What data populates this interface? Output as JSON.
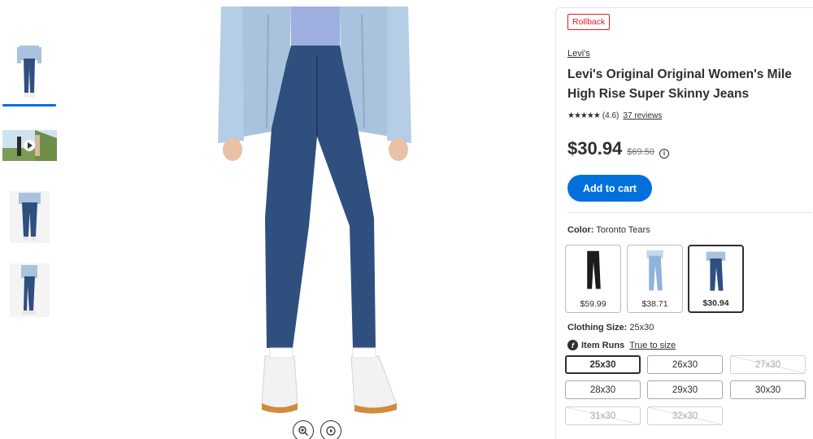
{
  "gallery": {
    "thumbnails": [
      {
        "alt": "front view",
        "selected": true
      },
      {
        "alt": "video thumbnail",
        "has_play": true
      },
      {
        "alt": "back view"
      },
      {
        "alt": "side view"
      }
    ],
    "controls": [
      "zoom-icon",
      "play-icon"
    ]
  },
  "product": {
    "badge": "Rollback",
    "brand": "Levi's",
    "title": "Levi's Original Original Women's Mile High Rise Super Skinny Jeans",
    "rating_value": "(4.6)",
    "reviews": "37 reviews",
    "stars": "★★★★★",
    "price": "$30.94",
    "was_price": "$69.50",
    "info_icon": "i",
    "add_to_cart": "Add to cart"
  },
  "color": {
    "label": "Color:",
    "value": "Toronto Tears",
    "swatches": [
      {
        "price": "$59.99",
        "jean": "#1b1b1d"
      },
      {
        "price": "$38.71",
        "jean": "#8fb3d9"
      },
      {
        "price": "$30.94",
        "jean": "#2f4f7f",
        "selected": true
      }
    ]
  },
  "size": {
    "label": "Clothing Size:",
    "value": "25x30",
    "runs_label": "Item Runs",
    "runs_value": "True to size",
    "runs_icon": "f",
    "options": [
      {
        "label": "25x30",
        "state": "selected"
      },
      {
        "label": "26x30",
        "state": "available"
      },
      {
        "label": "27x30",
        "state": "unavailable"
      },
      {
        "label": "28x30",
        "state": "available"
      },
      {
        "label": "29x30",
        "state": "available"
      },
      {
        "label": "30x30",
        "state": "available"
      },
      {
        "label": "31x30",
        "state": "unavailable"
      },
      {
        "label": "32x30",
        "state": "unavailable"
      }
    ]
  },
  "colors": {
    "accent": "#0071dc",
    "rollback": "#de1c24",
    "text": "#2e2f32",
    "denim_main": "#2f4f7f",
    "jacket": "#a9c3df"
  }
}
